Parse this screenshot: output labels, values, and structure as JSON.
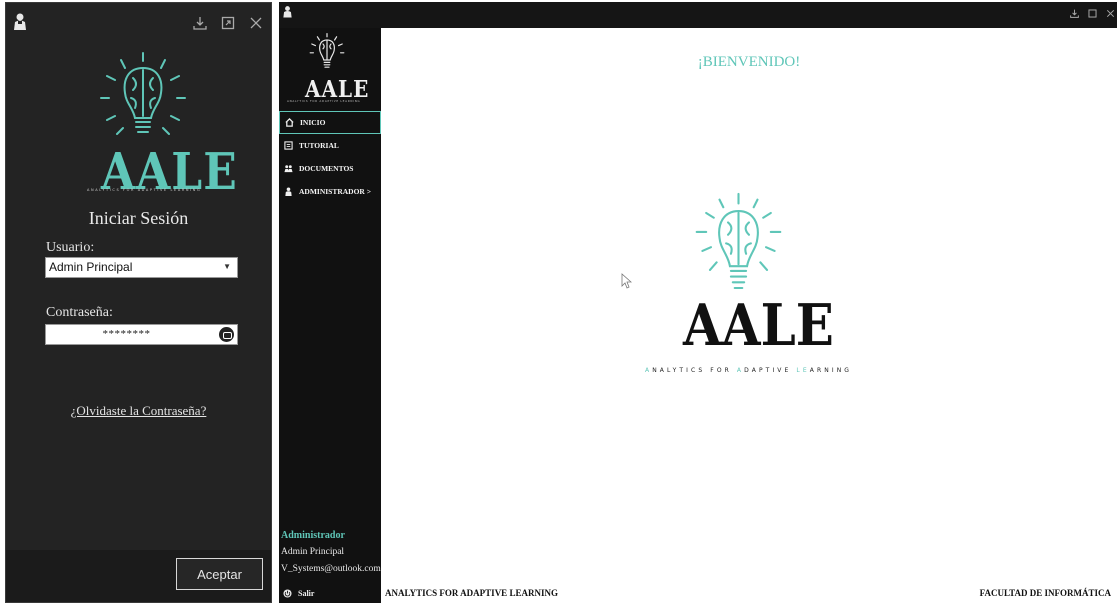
{
  "login": {
    "brand": "AALE",
    "brand_tagline": "ANALYTICS FOR ADAPTIVE LEARNING",
    "heading": "Iniciar Sesión",
    "user_label": "Usuario:",
    "user_value": "Admin Principal",
    "password_label": "Contraseña:",
    "password_mask": "********",
    "forgot_link": "¿Olvidaste la Contraseña?",
    "accept_button": "Aceptar"
  },
  "main": {
    "brand": "AALE",
    "brand_tagline": "ANALYTICS FOR ADAPTIVE LEARNING",
    "nav": [
      {
        "label": "INICIO",
        "icon": "home-icon",
        "active": true
      },
      {
        "label": "TUTORIAL",
        "icon": "tutorial-icon",
        "active": false
      },
      {
        "label": "DOCUMENTOS",
        "icon": "documents-icon",
        "active": false
      },
      {
        "label": "ADMINISTRADOR  >",
        "icon": "admin-icon",
        "active": false
      }
    ],
    "user": {
      "role": "Administrador",
      "name": "Admin Principal",
      "email": "V_Systems@outlook.com"
    },
    "logout": "Salir",
    "welcome": "¡BIENVENIDO!",
    "center_brand": "AALE",
    "center_tagline_parts": [
      "A",
      "NALYTICS FOR ",
      "A",
      "DAPTIVE ",
      "LE",
      "ARNING"
    ],
    "status_left": "ANALYTICS FOR ADAPTIVE LEARNING",
    "status_right": "FACULTAD DE INFORMÁTICA"
  },
  "colors": {
    "accent": "#5fc6b8",
    "login_bg": "#232323",
    "sidebar_bg": "#111111",
    "topbar_bg": "#151515"
  }
}
